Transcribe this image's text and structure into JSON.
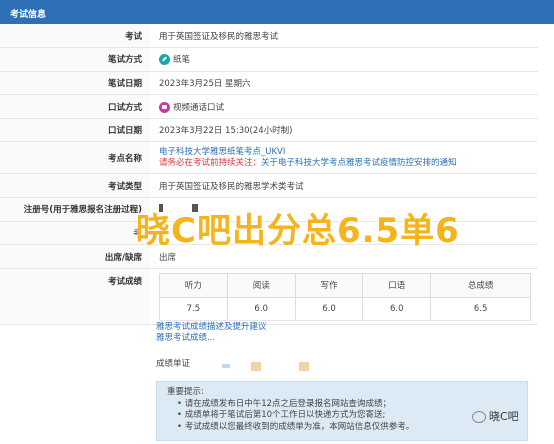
{
  "header": {
    "title": "考试信息"
  },
  "rows": [
    {
      "label": "考试",
      "value": "用于英国签证及移民的雅思考试"
    },
    {
      "label": "笔试方式",
      "value": "纸笔"
    },
    {
      "label": "笔试日期",
      "value": "2023年3月25日 星期六"
    },
    {
      "label": "口试方式",
      "value": "视频通话口试"
    },
    {
      "label": "口试日期",
      "value": "2023年3月22日 15:30(24小时制)"
    },
    {
      "label": "考点名称",
      "value": "电子科技大学雅思纸笔考点_UKVI",
      "notice_prefix": "请务必在考试前持续关注：",
      "notice_link": "关于电子科技大学考点雅思考试疫情防控安排的通知"
    },
    {
      "label": "考试类型",
      "value": "用于英国签证及移民的雅思学术类考试"
    },
    {
      "label": "注册号(用于雅思报名注册过程)",
      "value": ""
    },
    {
      "label": "考",
      "value": ""
    },
    {
      "label": "出席/缺席",
      "value": "出席"
    },
    {
      "label": "考试成绩",
      "value": ""
    }
  ],
  "scores": {
    "headers": [
      "听力",
      "阅读",
      "写作",
      "口语",
      "总成绩"
    ],
    "values": [
      "7.5",
      "6.0",
      "6.0",
      "6.0",
      "6.5"
    ]
  },
  "links": {
    "advice": "雅思考试成绩描述及提升建议",
    "other": "雅思考试成绩..."
  },
  "certificate": {
    "label": "成绩单证"
  },
  "tip": {
    "title": "重要提示:",
    "items": [
      "请在成绩发布日中午12点之后登录报名网站查询成绩；",
      "成绩单将于笔试后第10个工作日以快递方式为您寄送;",
      "考试成绩以您最终收到的成绩单为准，本网站信息仅供参考。"
    ]
  },
  "overlay": {
    "text": "晓C吧出分总6.5单6"
  },
  "watermark": {
    "text": "晓C吧"
  },
  "colors": {
    "header": "#2f6fb6",
    "overlay": "#f5b51a",
    "warn": "#d9363e",
    "link": "#2a6fb8"
  }
}
